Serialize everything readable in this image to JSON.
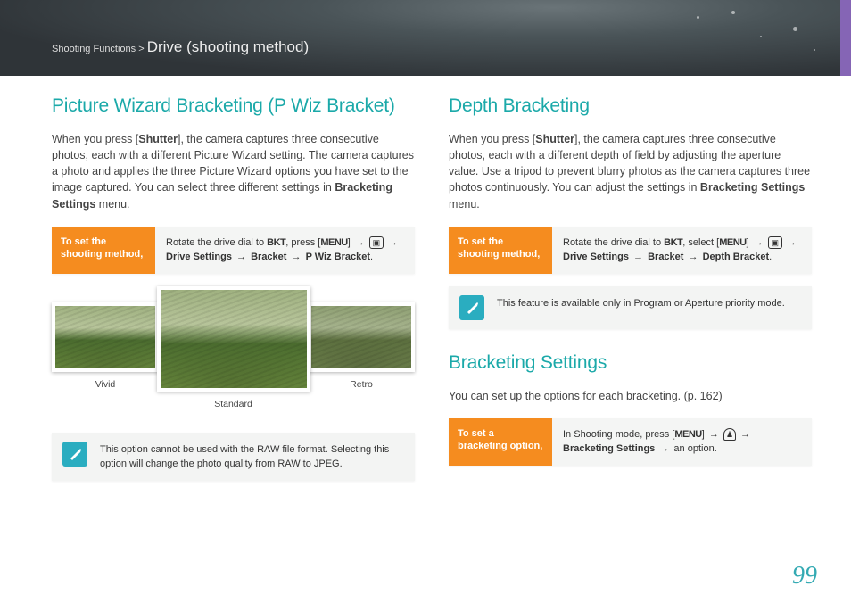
{
  "header": {
    "breadcrumb_prefix": "Shooting Functions > ",
    "breadcrumb_title": "Drive (shooting method)"
  },
  "left": {
    "heading": "Picture Wizard Bracketing (P Wiz Bracket)",
    "paragraph_a": "When you press [",
    "paragraph_shutter": "Shutter",
    "paragraph_b": "], the camera captures three consecutive photos, each with a different Picture Wizard setting. The camera captures a photo and applies the three Picture Wizard options you have set to the image captured. You can select three different settings in ",
    "paragraph_bold_end": "Bracketing Settings",
    "paragraph_tail": " menu.",
    "instr_label": "To set the shooting method,",
    "instr_body_1": "Rotate the drive dial to ",
    "instr_bkt": "BKT",
    "instr_body_2": ", press [",
    "instr_menu": "MENU",
    "instr_body_3": "] ",
    "instr_arrow": "→",
    "instr_drive": "Drive Settings",
    "instr_bracket": "Bracket",
    "instr_final": "P Wiz Bracket",
    "instr_period": ".",
    "caption_left": "Vivid",
    "caption_center": "Standard",
    "caption_right": "Retro",
    "note": "This option cannot be used with the RAW file format. Selecting this option will change the photo quality from RAW to JPEG."
  },
  "right": {
    "depth": {
      "heading": "Depth Bracketing",
      "para_a": "When you press [",
      "para_shutter": "Shutter",
      "para_b": "], the camera captures three consecutive photos, each with a different depth of field by adjusting the aperture value. Use a tripod to prevent blurry photos as the camera captures three photos continuously. You can adjust the settings in ",
      "para_bold": "Bracketing Settings",
      "para_tail": " menu.",
      "instr_label": "To set the shooting method,",
      "instr_1": "Rotate the drive dial to ",
      "instr_bkt": "BKT",
      "instr_2": ", select [",
      "instr_menu": "MENU",
      "instr_3": "] ",
      "instr_arrow": "→",
      "instr_drive": "Drive Settings",
      "instr_bracket": "Bracket",
      "instr_final": "Depth Bracket",
      "instr_period": ".",
      "note": "This feature is available only in Program or Aperture priority mode."
    },
    "bs": {
      "heading": "Bracketing Settings",
      "para": "You can set up the options for each bracketing. (p. 162)",
      "instr_label": "To set a bracketing option,",
      "instr_1": "In Shooting mode, press [",
      "instr_menu": "MENU",
      "instr_2": "] ",
      "instr_arrow": "→",
      "instr_bold": "Bracketing Settings",
      "instr_tail": " an option."
    }
  },
  "page_number": "99"
}
